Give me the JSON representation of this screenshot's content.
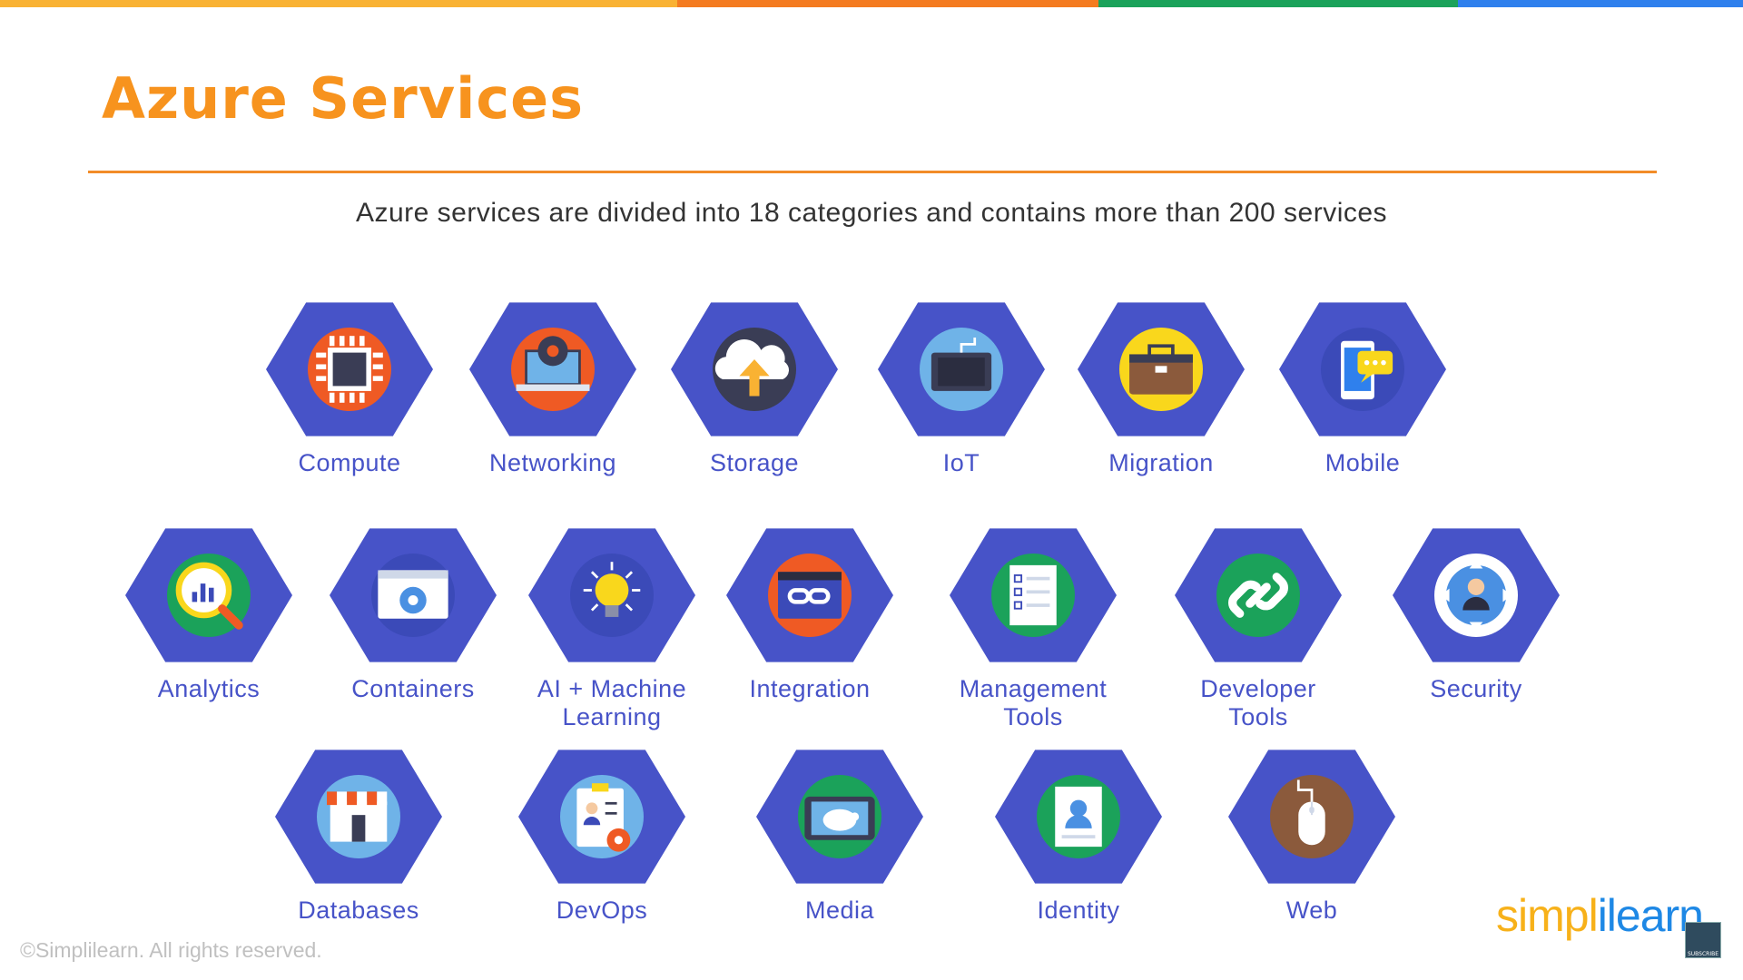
{
  "slide": {
    "title": "Azure Services",
    "subtitle": "Azure services are divided into 18 categories and contains more than 200 services",
    "copyright": "©Simplilearn. All rights reserved.",
    "logo_part1": "simpl",
    "logo_part2": "ilearn",
    "badge_text": "SUBSCRIBE"
  },
  "colors": {
    "title": "#F7931E",
    "hex": "#4753C8",
    "label": "#4753C8",
    "topbar": [
      "#F9B233",
      "#F47B20",
      "#1BA25A",
      "#2F80ED"
    ]
  },
  "services": [
    {
      "label": "Compute",
      "icon": "cpu-chip-icon"
    },
    {
      "label": "Networking",
      "icon": "laptop-gear-icon"
    },
    {
      "label": "Storage",
      "icon": "cloud-upload-icon"
    },
    {
      "label": "IoT",
      "icon": "iot-device-icon"
    },
    {
      "label": "Migration",
      "icon": "briefcase-icon"
    },
    {
      "label": "Mobile",
      "icon": "mobile-chat-icon"
    },
    {
      "label": "Analytics",
      "icon": "magnifier-chart-icon"
    },
    {
      "label": "Containers",
      "icon": "window-gear-icon"
    },
    {
      "label": "AI + Machine\nLearning",
      "icon": "lightbulb-icon"
    },
    {
      "label": "Integration",
      "icon": "window-link-icon"
    },
    {
      "label": "Management\nTools",
      "icon": "checklist-document-icon"
    },
    {
      "label": "Developer\nTools",
      "icon": "chain-link-icon"
    },
    {
      "label": "Security",
      "icon": "user-target-icon"
    },
    {
      "label": "Databases",
      "icon": "storefront-icon"
    },
    {
      "label": "DevOps",
      "icon": "clipboard-gear-icon"
    },
    {
      "label": "Media",
      "icon": "tablet-piggy-icon"
    },
    {
      "label": "Identity",
      "icon": "id-card-icon"
    },
    {
      "label": "Web",
      "icon": "mouse-icon"
    }
  ]
}
